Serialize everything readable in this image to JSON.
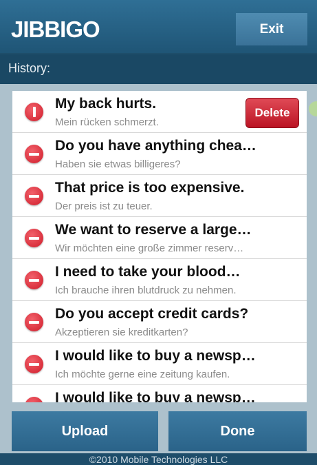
{
  "app": {
    "logo_text": "JIBBIGO",
    "exit_label": "Exit"
  },
  "history": {
    "label": "History:",
    "delete_label": "Delete",
    "items": [
      {
        "title": "My back hurts.",
        "subtitle": "Mein rücken schmerzt."
      },
      {
        "title": "Do you have anything chea…",
        "subtitle": "Haben sie etwas billigeres?"
      },
      {
        "title": "That price is too expensive.",
        "subtitle": "Der preis ist zu teuer."
      },
      {
        "title": "We want to reserve a large…",
        "subtitle": "Wir möchten eine große zimmer reserv…"
      },
      {
        "title": "I need to take your blood…",
        "subtitle": "Ich brauche ihren blutdruck zu nehmen."
      },
      {
        "title": "Do you accept credit cards?",
        "subtitle": "Akzeptieren sie kreditkarten?"
      },
      {
        "title": "I would like to buy a newsp…",
        "subtitle": "Ich möchte gerne eine zeitung kaufen."
      },
      {
        "title": "I would like to buy a newsp…",
        "subtitle": ""
      }
    ]
  },
  "actions": {
    "upload_label": "Upload",
    "done_label": "Done"
  },
  "footer": {
    "copyright": "©2010 Mobile Technologies LLC"
  }
}
